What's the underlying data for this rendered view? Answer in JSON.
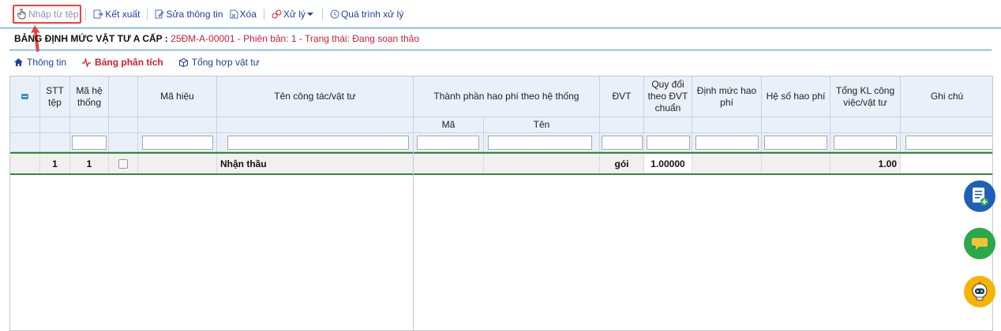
{
  "toolbar": {
    "import": "Nhập từ tệp",
    "export": "Kết xuất",
    "edit": "Sửa thông tin",
    "delete": "Xóa",
    "process": "Xử lý",
    "history": "Quá trình xử lý"
  },
  "header": {
    "label": "BẢNG ĐỊNH MỨC VẬT TƯ A CẤP :",
    "value": "25ĐM-A-00001 - Phiên bản: 1 - Trạng thái: Đang soạn thảo"
  },
  "tabs": [
    {
      "label": "Thông tin",
      "icon": "home-icon",
      "active": false
    },
    {
      "label": "Bảng phân tích",
      "icon": "pulse-icon",
      "active": true
    },
    {
      "label": "Tổng hợp vật tư",
      "icon": "box-icon",
      "active": false
    }
  ],
  "columns": {
    "stt": "STT tệp",
    "ma_he_thong": "Mã hệ thống",
    "ma_hieu": "Mã hiệu",
    "ten": "Tên công tác/vật tư",
    "thanh_phan": "Thành phần hao phí theo hệ thống",
    "thanh_phan_ma": "Mã",
    "thanh_phan_ten": "Tên",
    "dvt": "ĐVT",
    "quy_doi": "Quy đổi theo ĐVT chuẩn",
    "dinh_muc": "Định mức hao phí",
    "he_so": "Hệ số hao phí",
    "tong_kl": "Tổng KL công việc/vật tư",
    "ghi_chu": "Ghi chú"
  },
  "rows": [
    {
      "stt": "1",
      "ma_he_thong": "1",
      "ma_hieu": "",
      "ten": "Nhận thầu",
      "dvt": "gói",
      "quy_doi": "1.00000",
      "tong_kl": "1.00",
      "ghi_chu": ""
    }
  ],
  "colors": {
    "accent": "#1f3f9e",
    "active_tab": "#d0202d",
    "status": "#c0233a",
    "row_border": "#2f8a3a"
  }
}
